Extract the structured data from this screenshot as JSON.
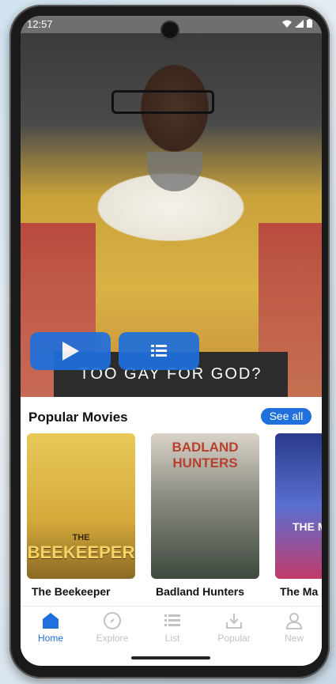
{
  "status": {
    "time": "12:57"
  },
  "hero": {
    "title": "TOO GAY FOR GOD?"
  },
  "popular": {
    "heading": "Popular Movies",
    "see_all": "See all",
    "movies": [
      {
        "title": "The Beekeeper",
        "poster_text": "BEEKEEPER",
        "poster_top": "THE"
      },
      {
        "title": "Badland Hunters",
        "poster_text": "BADLAND HUNTERS"
      },
      {
        "title": "The Ma",
        "poster_text": "THE M"
      }
    ]
  },
  "nav": {
    "items": [
      {
        "label": "Home",
        "icon": "home-icon",
        "active": true
      },
      {
        "label": "Explore",
        "icon": "compass-icon"
      },
      {
        "label": "List",
        "icon": "list-icon"
      },
      {
        "label": "Popular",
        "icon": "download-icon"
      },
      {
        "label": "New",
        "icon": "person-icon"
      }
    ]
  },
  "colors": {
    "accent": "#1f6fdc"
  }
}
